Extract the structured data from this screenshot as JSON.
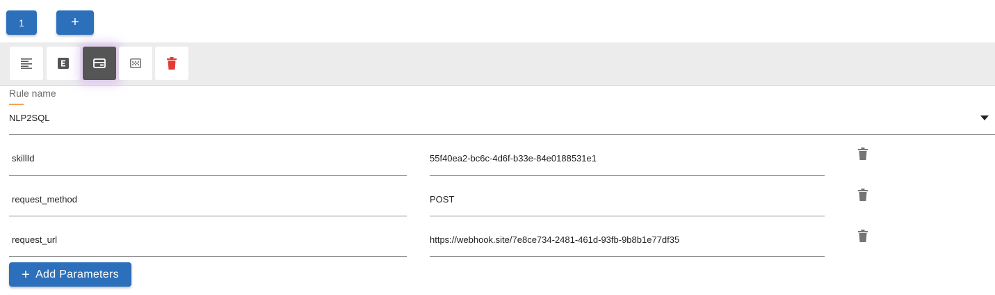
{
  "tabs": [
    {
      "label": "1"
    },
    {
      "label": "+"
    }
  ],
  "toolbar": {
    "tools": [
      {
        "icon": "text-align-icon"
      },
      {
        "icon": "e-box-icon"
      },
      {
        "icon": "card-icon",
        "active": true
      },
      {
        "icon": "pattern-icon"
      },
      {
        "icon": "trash-icon",
        "color": "#e53935"
      }
    ]
  },
  "rule": {
    "label": "Rule name",
    "value": "NLP2SQL"
  },
  "parameters": [
    {
      "key": "skillId",
      "value": "55f40ea2-bc6c-4d6f-b33e-84e0188531e1"
    },
    {
      "key": "request_method",
      "value": "POST"
    },
    {
      "key": "request_url",
      "value": "https://webhook.site/7e8ce734-2481-461d-93fb-9b8b1e77df35"
    }
  ],
  "add_button": {
    "plus": "+",
    "label": "Add Parameters"
  },
  "colors": {
    "primary": "#2c6fbb",
    "danger": "#e53935",
    "accent": "#f0a35e"
  }
}
